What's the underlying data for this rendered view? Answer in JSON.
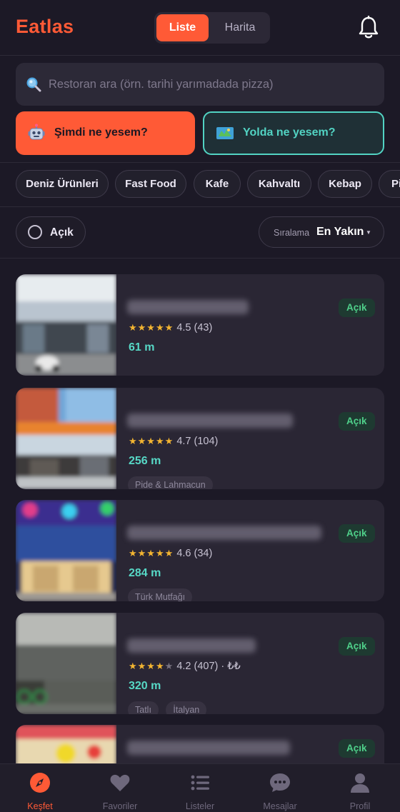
{
  "header": {
    "logo": "Eatlas",
    "view_toggle": {
      "active": "Liste",
      "inactive": "Harita"
    }
  },
  "search": {
    "placeholder": "Restoran ara (örn. tarihi yarımadada pizza)",
    "value": ""
  },
  "actions": [
    {
      "label": "Şimdi ne yesem?",
      "icon": "robot-icon"
    },
    {
      "label": "Yolda ne yesem?",
      "icon": "map-icon"
    }
  ],
  "categories": [
    "Deniz Ürünleri",
    "Fast Food",
    "Kafe",
    "Kahvaltı",
    "Kebap",
    "Pi"
  ],
  "filters": {
    "open_label": "Açık",
    "open_checked": false,
    "sort_label": "Sıralama",
    "sort_value": "En Yakın"
  },
  "colors": {
    "accent": "#ff5a36",
    "teal": "#57d8c6",
    "open_green": "#4fd08a",
    "star": "#f3b531"
  },
  "restaurants": [
    {
      "rating": "4.5",
      "reviews": "(43)",
      "stars": 5,
      "price": "",
      "distance": "61 m",
      "status": "Açık",
      "tags": []
    },
    {
      "rating": "4.7",
      "reviews": "(104)",
      "stars": 5,
      "price": "",
      "distance": "256 m",
      "status": "Açık",
      "tags": [
        "Pide & Lahmacun"
      ]
    },
    {
      "rating": "4.6",
      "reviews": "(34)",
      "stars": 5,
      "price": "",
      "distance": "284 m",
      "status": "Açık",
      "tags": [
        "Türk Mutfağı"
      ]
    },
    {
      "rating": "4.2",
      "reviews": "(407)",
      "stars": 4,
      "price": "· ₺₺",
      "distance": "320 m",
      "status": "Açık",
      "tags": [
        "Tatlı",
        "İtalyan"
      ]
    },
    {
      "rating": "",
      "reviews": "",
      "stars": 0,
      "price": "",
      "distance": "",
      "status": "Açık",
      "tags": []
    }
  ],
  "nav": [
    {
      "label": "Keşfet",
      "icon": "compass-icon",
      "active": true
    },
    {
      "label": "Favoriler",
      "icon": "heart-icon",
      "active": false
    },
    {
      "label": "Listeler",
      "icon": "list-icon",
      "active": false
    },
    {
      "label": "Mesajlar",
      "icon": "chat-icon",
      "active": false
    },
    {
      "label": "Profil",
      "icon": "person-icon",
      "active": false
    }
  ]
}
